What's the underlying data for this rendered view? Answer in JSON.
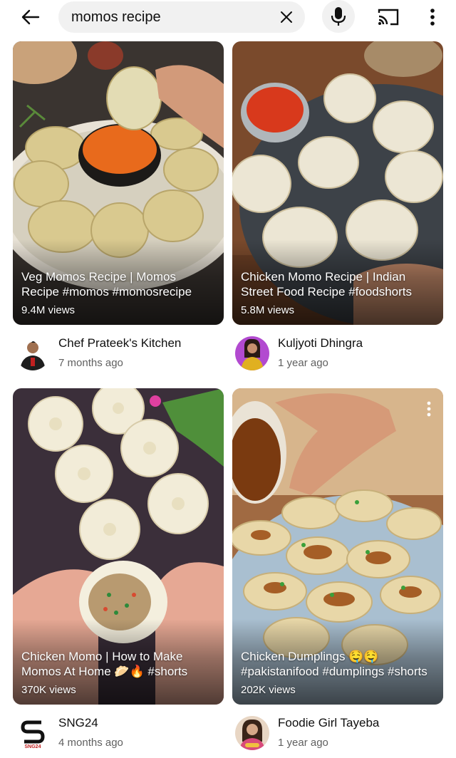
{
  "search": {
    "query": "momos recipe"
  },
  "colors": {
    "background": "#ffffff",
    "search_bg": "#f1f1f1",
    "text": "#0f0f0f",
    "secondary_text": "#606060"
  },
  "icons": {
    "back": "arrow-back-icon",
    "clear": "close-icon",
    "mic": "microphone-icon",
    "cast": "cast-icon",
    "more": "more-vertical-icon"
  },
  "videos": [
    {
      "title": "Veg Momos Recipe | Momos Recipe #momos #momosrecipe",
      "views": "9.4M views",
      "channel": "Chef Prateek's Kitchen",
      "age": "7 months ago"
    },
    {
      "title": "Chicken Momo Recipe | Indian Street Food Recipe #foodshorts",
      "views": "5.8M views",
      "channel": "Kuljyoti Dhingra",
      "age": "1 year ago"
    },
    {
      "title": "Chicken Momo | How to Make Momos At Home 🥟🔥 #shorts",
      "views": "370K views",
      "channel": "SNG24",
      "age": "4 months ago"
    },
    {
      "title": "Chicken Dumplings 🤤🤤 #pakistanifood #dumplings #shorts",
      "views": "202K views",
      "channel": "Foodie Girl Tayeba",
      "age": "1 year ago"
    }
  ],
  "avatars": {
    "sng24_logo_text": "SNG24"
  }
}
